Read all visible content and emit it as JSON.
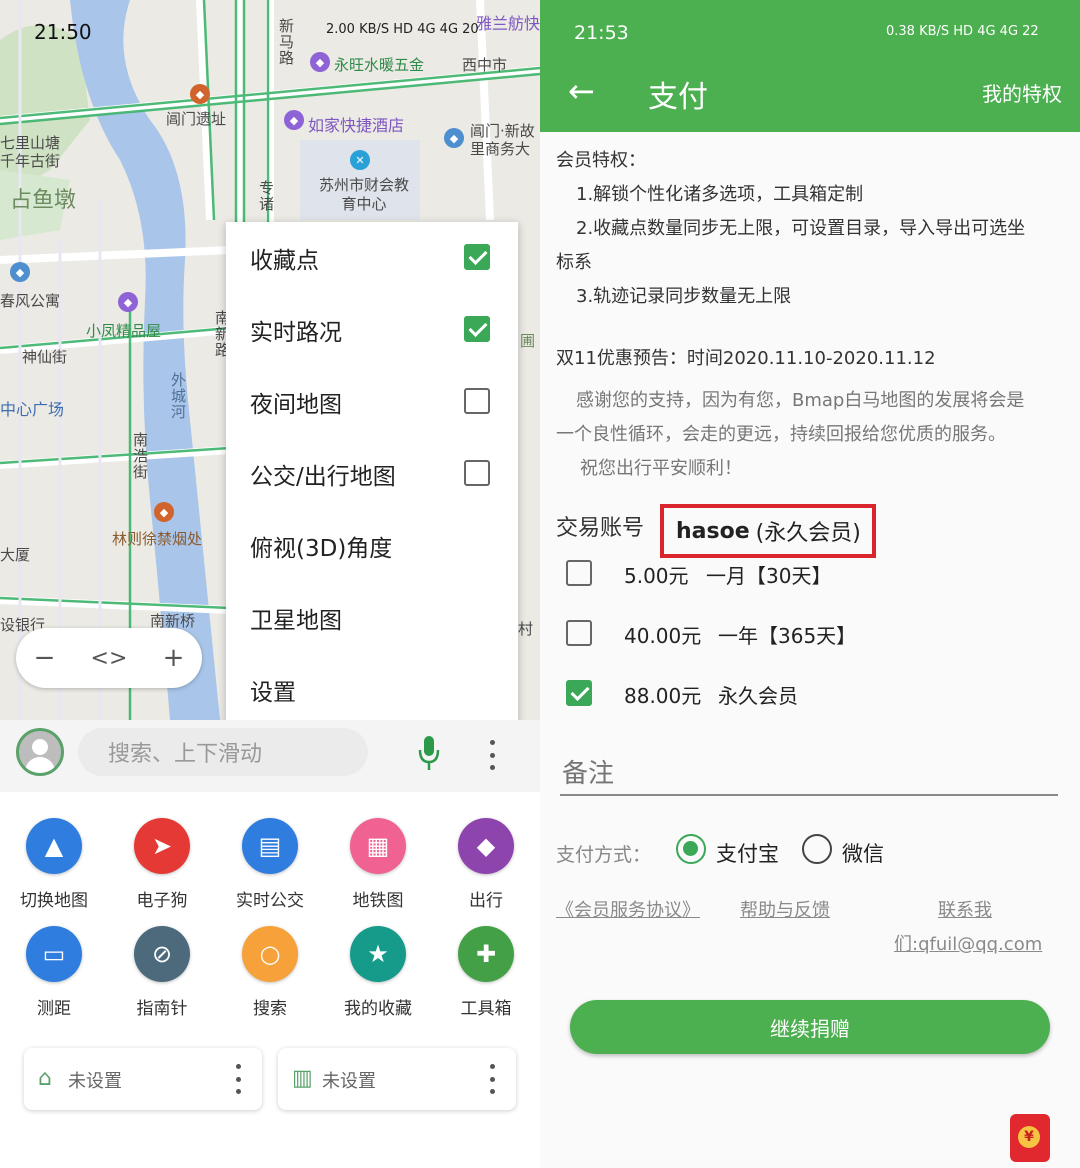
{
  "left": {
    "status": {
      "time": "21:50",
      "indicators": "2.00 KB/S HD 4G 4G 20"
    },
    "map_labels": {
      "xinma_road": "新马路",
      "hardware_store": "永旺水暖五金",
      "xizhongshi": "西中市",
      "yabang": "雅兰舫快",
      "changmen_site": "阊门遗址",
      "rujia_hotel": "如家快捷酒店",
      "changmen_xindu": "阊门·新故里商务大",
      "qilishantang": "七里山塘千年古街",
      "zhanyudun": "占鱼墩",
      "finance_center": "苏州市财会教育中心",
      "zhuanzhu": "专诸",
      "fengfeng_apt": "春风公寓",
      "xiaofeng_shop": "小凤精品屋",
      "shenxian_st": "神仙街",
      "center_square": "中心广场",
      "waicheng_river": "外城河",
      "nanhao_st": "南浩街",
      "linzexu": "林则徐禁烟处",
      "building": "大厦",
      "bank": "设银行",
      "nanxin_bridge": "南新桥",
      "nanxin_road": "南新路",
      "yuan": "圃",
      "cun": "村"
    },
    "zoom": {
      "minus": "−",
      "center": "<>",
      "plus": "+"
    },
    "menu": [
      {
        "label": "收藏点",
        "checkbox": true,
        "checked": true
      },
      {
        "label": "实时路况",
        "checkbox": true,
        "checked": true
      },
      {
        "label": "夜间地图",
        "checkbox": true,
        "checked": false
      },
      {
        "label": "公交/出行地图",
        "checkbox": true,
        "checked": false
      },
      {
        "label": "俯视(3D)角度",
        "checkbox": false
      },
      {
        "label": "卫星地图",
        "checkbox": false
      },
      {
        "label": "设置",
        "checkbox": false
      }
    ],
    "search": {
      "placeholder": "搜索、上下滑动"
    },
    "tools": [
      {
        "label": "切换地图",
        "icon": "layers-icon",
        "color": "#2f7ddf"
      },
      {
        "label": "电子狗",
        "icon": "navigate-icon",
        "color": "#e53935"
      },
      {
        "label": "实时公交",
        "icon": "bus-icon",
        "color": "#2f7ddf"
      },
      {
        "label": "地铁图",
        "icon": "subway-icon",
        "color": "#f06292"
      },
      {
        "label": "出行",
        "icon": "directions-icon",
        "color": "#8e44ad"
      },
      {
        "label": "测距",
        "icon": "ruler-icon",
        "color": "#2f7ddf"
      },
      {
        "label": "指南针",
        "icon": "compass-icon",
        "color": "#4c6a7c"
      },
      {
        "label": "搜索",
        "icon": "search-icon",
        "color": "#f6a13a"
      },
      {
        "label": "我的收藏",
        "icon": "star-icon",
        "color": "#169a8a"
      },
      {
        "label": "工具箱",
        "icon": "puzzle-icon",
        "color": "#43a047"
      }
    ],
    "cards": [
      {
        "label": "未设置",
        "icon": "home-icon"
      },
      {
        "label": "未设置",
        "icon": "company-icon"
      }
    ]
  },
  "right": {
    "status": {
      "time": "21:53",
      "indicators": "0.38 KB/S HD 4G 4G 22"
    },
    "appbar": {
      "title": "支付",
      "action": "我的特权"
    },
    "privileges": {
      "heading": "会员特权：",
      "items": [
        "1.解锁个性化诸多选项，工具箱定制",
        "2.收藏点数量同步无上限，可设置目录，导入导出可选坐",
        "标系",
        "3.轨迹记录同步数量无上限"
      ]
    },
    "promo": "双11优惠预告：时间2020.11.10-2020.11.12",
    "thanks": [
      "感谢您的支持，因为有您，Bmap白马地图的发展将会是",
      "一个良性循环，会走的更远，持续回报给您优质的服务。",
      "祝您出行平安顺利！"
    ],
    "account": {
      "label": "交易账号",
      "name": "hasoe",
      "level": "(永久会员)"
    },
    "plans": [
      {
        "price": "5.00元",
        "desc": "一月【30天】",
        "checked": false
      },
      {
        "price": "40.00元",
        "desc": "一年【365天】",
        "checked": false
      },
      {
        "price": "88.00元",
        "desc": "永久会员",
        "checked": true
      }
    ],
    "remark_placeholder": "备注",
    "payment": {
      "label": "支付方式：",
      "options": [
        {
          "label": "支付宝",
          "selected": true
        },
        {
          "label": "微信",
          "selected": false
        }
      ]
    },
    "links": {
      "agreement": "《会员服务协议》",
      "help": "帮助与反馈",
      "contact": "联系我",
      "email": "们:qfuil@qq.com"
    },
    "donate_button": "继续捐赠"
  },
  "colors": {
    "accent_green": "#4caf50",
    "check_green": "#3aa856",
    "highlight_red": "#d9252b"
  }
}
